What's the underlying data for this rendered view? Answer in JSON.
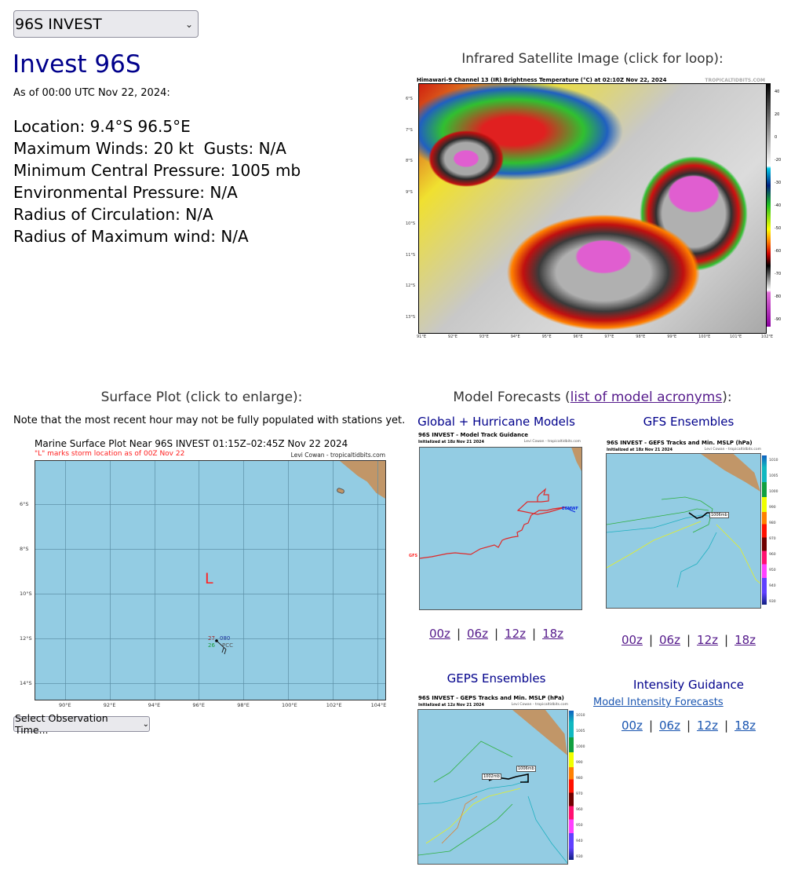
{
  "storm_selector": {
    "value": "96S INVEST",
    "icon": "chevron-down-icon"
  },
  "storm": {
    "title": "Invest 96S",
    "as_of": "As of 00:00 UTC Nov 22, 2024:",
    "location": "Location: 9.4°S 96.5°E",
    "winds": "Maximum Winds: 20 kt  Gusts: N/A",
    "pressure": "Minimum Central Pressure: 1005 mb",
    "env_pressure": "Environmental Pressure: N/A",
    "radius_circ": "Radius of Circulation: N/A",
    "radius_max_wind": "Radius of Maximum wind: N/A"
  },
  "satellite": {
    "heading": "Infrared Satellite Image (click for loop):",
    "caption": "Himawari-9 Channel 13 (IR) Brightness Temperature (°C) at 02:10Z Nov 22, 2024",
    "brand": "TROPICALTIDBITS.COM",
    "colorbar_labels": [
      "40",
      "20",
      "0",
      "-20",
      "-30",
      "-40",
      "-50",
      "-60",
      "-70",
      "-80",
      "-90"
    ],
    "lat_labels": [
      "6°S",
      "7°S",
      "8°S",
      "9°S",
      "10°S",
      "11°S",
      "12°S",
      "13°S"
    ],
    "lon_labels": [
      "91°E",
      "92°E",
      "93°E",
      "94°E",
      "95°E",
      "96°E",
      "97°E",
      "98°E",
      "99°E",
      "100°E",
      "101°E",
      "102°E"
    ]
  },
  "surface": {
    "heading": "Surface Plot (click to enlarge):",
    "note": "Note that the most recent hour may not be fully populated with stations yet.",
    "title": "Marine Surface Plot Near 96S INVEST 01:15Z–02:45Z Nov 22 2024",
    "subtitle": "\"L\" marks storm location as of 00Z Nov 22",
    "credit": "Levi Cowan - tropicaltidbits.com",
    "storm_marker": "L",
    "station": {
      "temp": "27",
      "dewpoint": "26",
      "pressure": "080",
      "id": "PCC"
    },
    "lat_labels": [
      "6°S",
      "8°S",
      "10°S",
      "12°S",
      "14°S"
    ],
    "lon_labels": [
      "90°E",
      "92°E",
      "94°E",
      "96°E",
      "98°E",
      "100°E",
      "102°E",
      "104°E"
    ],
    "obs_select": {
      "value": "Select Observation Time...",
      "icon": "chevron-down-icon"
    }
  },
  "models": {
    "heading_prefix": "Model Forecasts (",
    "heading_link": "list of model acronyms",
    "heading_suffix": "):",
    "global": {
      "label": "Global + Hurricane Models",
      "title": "96S INVEST - Model Track Guidance",
      "init": "Initialized at 18z Nov 21 2024",
      "credit": "Levi Cowan - tropicaltidbits.com",
      "model_labels": [
        "GFS",
        "ECMWF"
      ],
      "runs": [
        "00z",
        "06z",
        "12z",
        "18z"
      ]
    },
    "gfs": {
      "label": "GFS Ensembles",
      "title": "96S INVEST - GEFS Tracks and Min. MSLP (hPa)",
      "init": "Initialized at 18z Nov 21 2024",
      "credit": "Levi Cowan - tropicaltidbits.com",
      "annotation": "1006mb",
      "colorbar_labels": [
        "1010",
        "1005",
        "1000",
        "990",
        "980",
        "970",
        "960",
        "950",
        "940",
        "930"
      ],
      "runs": [
        "00z",
        "06z",
        "12z",
        "18z"
      ]
    },
    "geps": {
      "label": "GEPS Ensembles",
      "title": "96S INVEST - GEPS Tracks and Min. MSLP (hPa)",
      "init": "Initialized at 12z Nov 21 2024",
      "credit": "Levi Cowan - tropicaltidbits.com",
      "annotations": [
        "1002mb",
        "1006mb"
      ],
      "colorbar_labels": [
        "1010",
        "1005",
        "1000",
        "990",
        "980",
        "970",
        "960",
        "950",
        "940",
        "930"
      ]
    },
    "intensity": {
      "label": "Intensity Guidance",
      "link": "Model Intensity Forecasts",
      "runs": [
        "00z",
        "06z",
        "12z",
        "18z"
      ]
    }
  }
}
